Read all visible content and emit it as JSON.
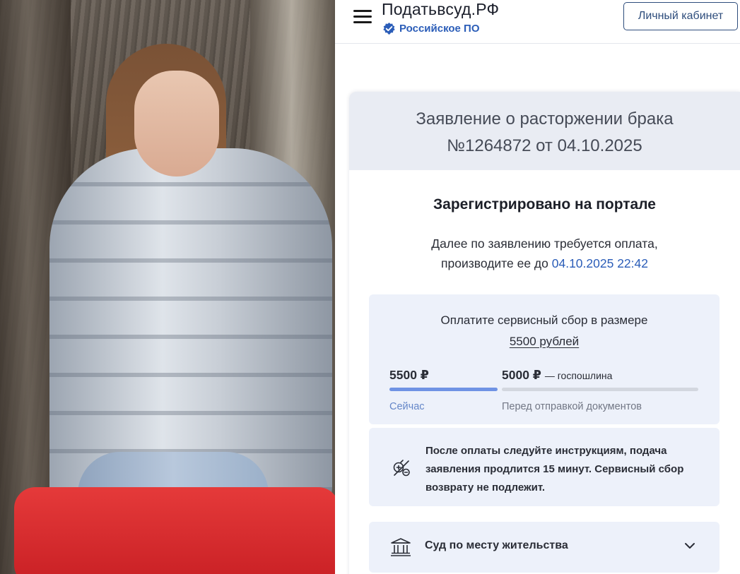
{
  "header": {
    "brand": "Податьвсуд.РФ",
    "verified_label": "Российское ПО",
    "cabinet_button": "Личный кабинет"
  },
  "application": {
    "title_line1": "Заявление о расторжении брака",
    "title_line2": "№1264872 от 04.10.2025",
    "status": "Зарегистрировано на портале",
    "notice_line1": "Далее по заявлению требуется оплата,",
    "notice_line2_prefix": "производите ее до",
    "notice_deadline": "04.10.2025 22:42"
  },
  "payment": {
    "caption": "Оплатите сервисный сбор в размере",
    "amount": "5500 рублей",
    "steps": [
      {
        "value": "5500 ₽",
        "note": "",
        "when": "Сейчас",
        "progress": 1.0
      },
      {
        "value": "5000 ₽",
        "note": "— госпошлина",
        "when": "Перед отправкой документов",
        "progress": 0.0
      }
    ]
  },
  "info": {
    "text": "После оплаты следуйте инструкциям, подача заявления продлится 15 минут. Сервисный сбор возврату не подлежит.",
    "icon": "no-refund-icon"
  },
  "court": {
    "label": "Суд по месту жительства",
    "icon": "court-building-icon"
  },
  "colors": {
    "accent": "#2b5db8",
    "progress": "#6f93e4",
    "panel": "#edf1fa",
    "card_header": "#e9ecf3",
    "button_border": "#2e4d7c"
  }
}
